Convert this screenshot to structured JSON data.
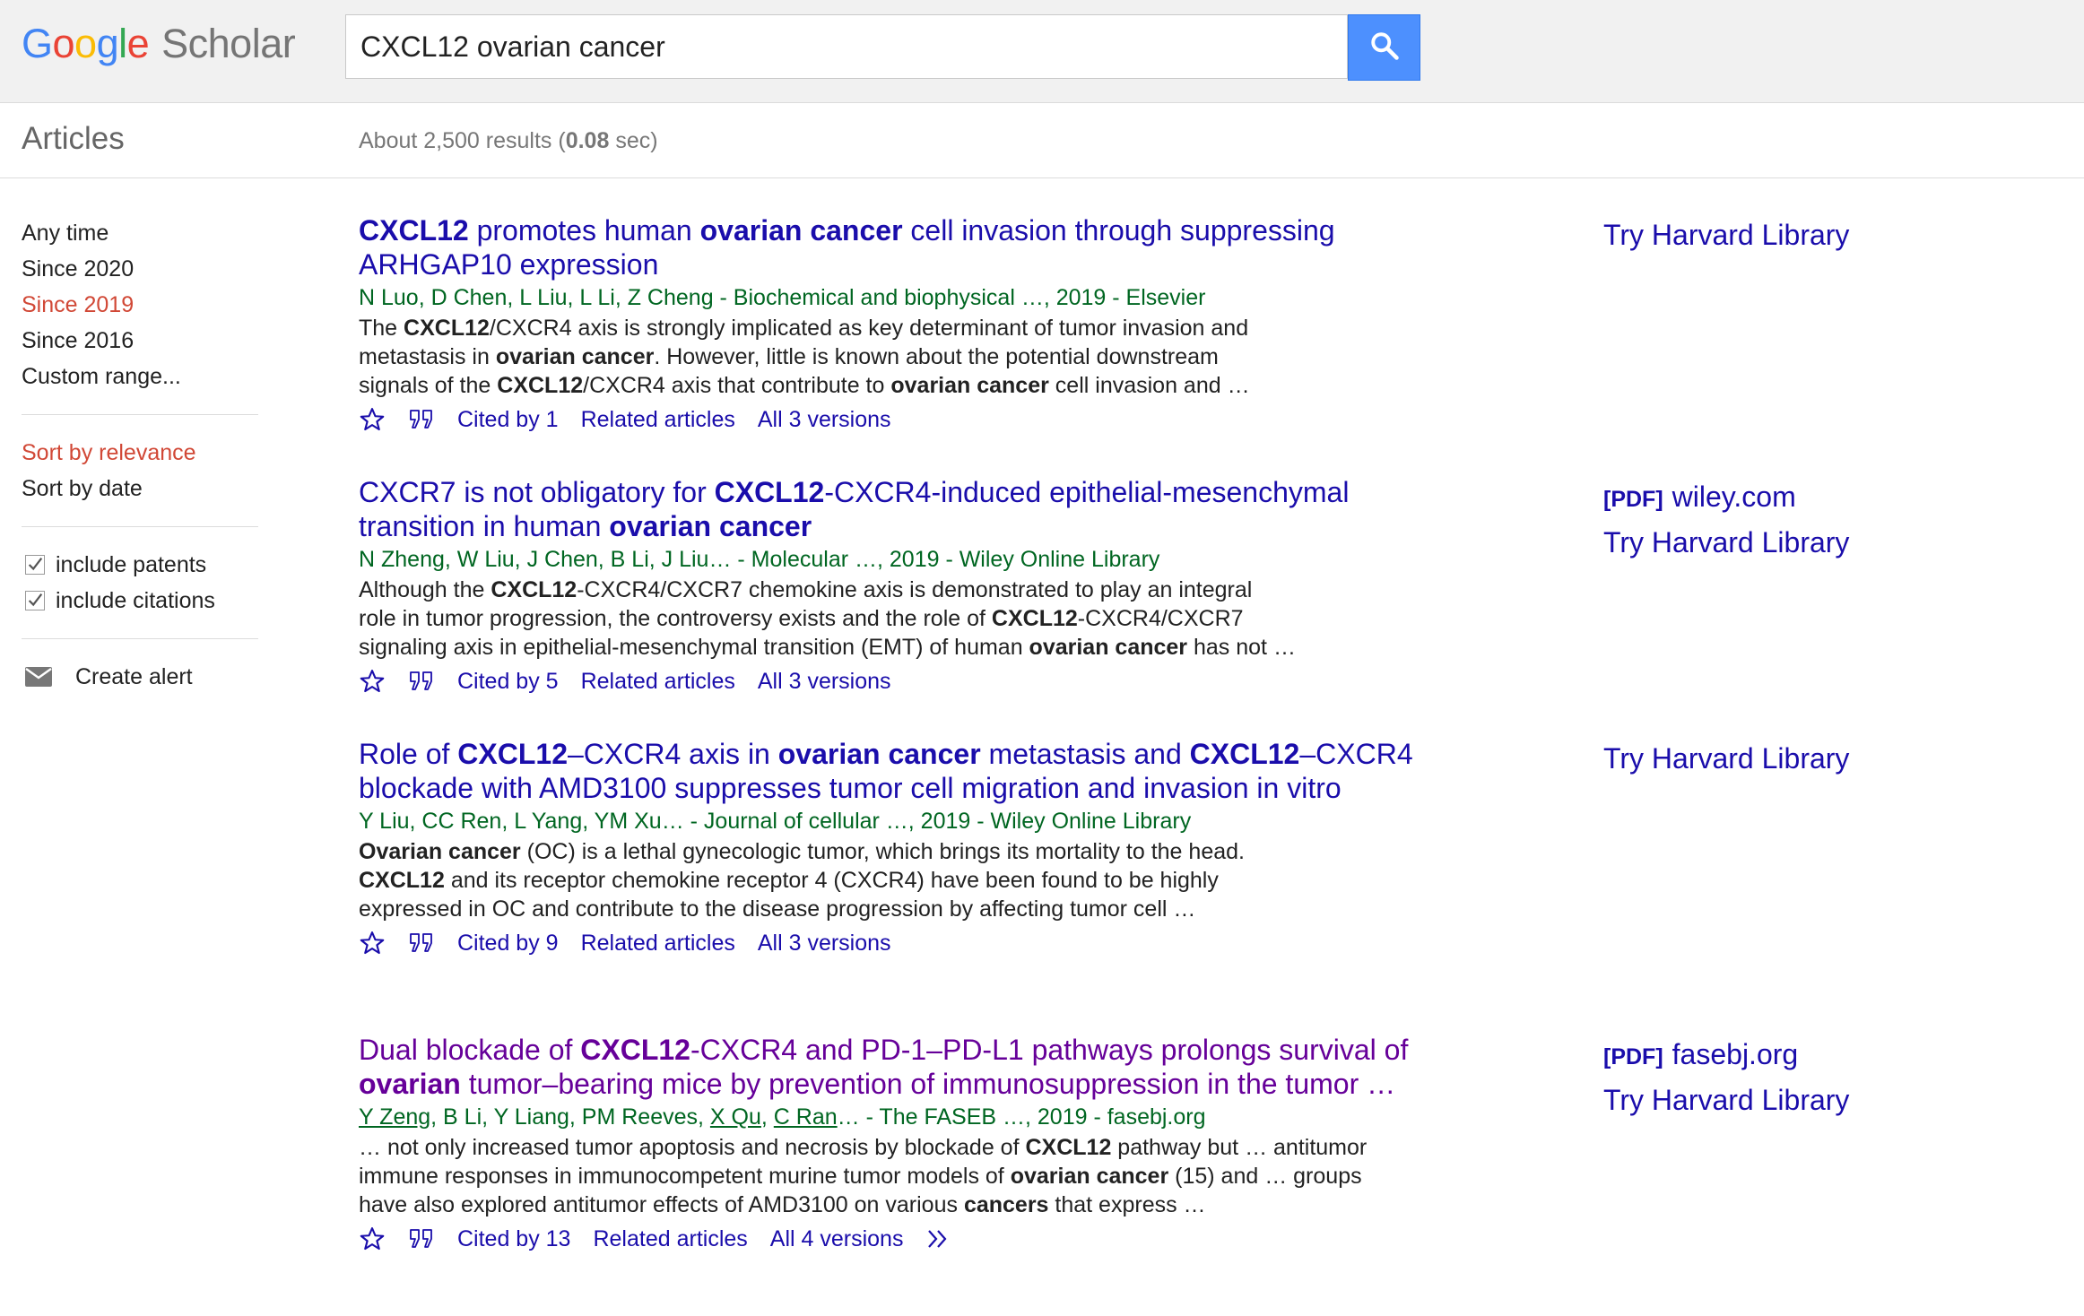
{
  "header": {
    "logo": {
      "google": [
        "G",
        "o",
        "o",
        "g",
        "l",
        "e"
      ],
      "scholar": "Scholar"
    },
    "search": {
      "value": "CXCL12 ovarian cancer"
    }
  },
  "subbar": {
    "section_label": "Articles",
    "results_prefix": "About 2,500 results (",
    "results_time": "0.08",
    "results_suffix": " sec)"
  },
  "sidebar": {
    "time_filters": [
      "Any time",
      "Since 2020",
      "Since 2019",
      "Since 2016",
      "Custom range..."
    ],
    "active_time_filter": "Since 2019",
    "sort_options": [
      "Sort by relevance",
      "Sort by date"
    ],
    "active_sort": "Sort by relevance",
    "include_patents": {
      "label": "include patents",
      "checked": true
    },
    "include_citations": {
      "label": "include citations",
      "checked": true
    },
    "create_alert": "Create alert"
  },
  "results": [
    {
      "title": [
        {
          "t": "CXCL12",
          "b": true
        },
        {
          "t": " promotes human "
        },
        {
          "t": "ovarian cancer",
          "b": true
        },
        {
          "t": " cell invasion through suppressing ARHGAP10 expression"
        }
      ],
      "visited": false,
      "meta": "N Luo, D Chen, L Liu, L Li, Z Cheng - Biochemical and biophysical …, 2019 - Elsevier",
      "snippet": [
        [
          {
            "t": "The "
          },
          {
            "t": "CXCL12",
            "b": true
          },
          {
            "t": "/CXCR4 axis is strongly implicated as key determinant of tumor invasion and"
          }
        ],
        [
          {
            "t": "metastasis in "
          },
          {
            "t": "ovarian cancer",
            "b": true
          },
          {
            "t": ". However, little is known about the potential downstream"
          }
        ],
        [
          {
            "t": "signals of the "
          },
          {
            "t": "CXCL12",
            "b": true
          },
          {
            "t": "/CXCR4 axis that contribute to "
          },
          {
            "t": "ovarian cancer",
            "b": true
          },
          {
            "t": " cell invasion and …"
          }
        ]
      ],
      "cited_by": "Cited by 1",
      "related": "Related articles",
      "versions": "All 3 versions",
      "side": [
        {
          "label": "Try Harvard Library"
        }
      ]
    },
    {
      "title": [
        {
          "t": "CXCR7 is not obligatory for "
        },
        {
          "t": "CXCL12",
          "b": true
        },
        {
          "t": "-CXCR4-induced epithelial-mesenchymal transition in human "
        },
        {
          "t": "ovarian cancer",
          "b": true
        }
      ],
      "visited": false,
      "meta": "N Zheng, W Liu, J Chen, B Li, J Liu… - Molecular …, 2019 - Wiley Online Library",
      "snippet": [
        [
          {
            "t": "Although the "
          },
          {
            "t": "CXCL12",
            "b": true
          },
          {
            "t": "-CXCR4/CXCR7 chemokine axis is demonstrated to play an integral"
          }
        ],
        [
          {
            "t": "role in tumor progression, the controversy exists and the role of "
          },
          {
            "t": "CXCL12",
            "b": true
          },
          {
            "t": "-CXCR4/CXCR7"
          }
        ],
        [
          {
            "t": "signaling axis in epithelial-mesenchymal transition (EMT) of human "
          },
          {
            "t": "ovarian cancer",
            "b": true
          },
          {
            "t": " has not …"
          }
        ]
      ],
      "cited_by": "Cited by 5",
      "related": "Related articles",
      "versions": "All 3 versions",
      "side": [
        {
          "pdf": "[PDF]",
          "label": "wiley.com"
        },
        {
          "label": "Try Harvard Library"
        }
      ]
    },
    {
      "title": [
        {
          "t": "Role of "
        },
        {
          "t": "CXCL12",
          "b": true
        },
        {
          "t": "–CXCR4 axis in "
        },
        {
          "t": "ovarian cancer",
          "b": true
        },
        {
          "t": " metastasis and "
        },
        {
          "t": "CXCL12",
          "b": true
        },
        {
          "t": "–CXCR4 blockade with AMD3100 suppresses tumor cell migration and invasion in vitro"
        }
      ],
      "visited": false,
      "meta": "Y Liu, CC Ren, L Yang, YM Xu… - Journal of cellular …, 2019 - Wiley Online Library",
      "snippet": [
        [
          {
            "t": "Ovarian cancer",
            "b": true
          },
          {
            "t": " (OC) is a lethal gynecologic tumor, which brings its mortality to the head."
          }
        ],
        [
          {
            "t": "CXCL12",
            "b": true
          },
          {
            "t": " and its receptor chemokine receptor 4 (CXCR4) have been found to be highly"
          }
        ],
        [
          {
            "t": "expressed in OC and contribute to the disease progression by affecting tumor cell …"
          }
        ]
      ],
      "cited_by": "Cited by 9",
      "related": "Related articles",
      "versions": "All 3 versions",
      "side": [
        {
          "label": "Try Harvard Library"
        }
      ]
    },
    {
      "title": [
        {
          "t": "Dual blockade of "
        },
        {
          "t": "CXCL12",
          "b": true
        },
        {
          "t": "-CXCR4 and PD-1–PD-L1 pathways prolongs survival of "
        },
        {
          "t": "ovarian",
          "b": true
        },
        {
          "t": " tumor–bearing mice by prevention of immunosuppression in the tumor …"
        }
      ],
      "visited": true,
      "meta_parts": [
        {
          "t": "Y Zeng",
          "u": true
        },
        {
          "t": ", B Li, Y Liang, PM Reeves, "
        },
        {
          "t": "X Qu",
          "u": true
        },
        {
          "t": ", "
        },
        {
          "t": "C Ran",
          "u": true
        },
        {
          "t": "… - The FASEB …, 2019 - fasebj.org"
        }
      ],
      "snippet": [
        [
          {
            "t": "… not only increased tumor apoptosis and necrosis by blockade of "
          },
          {
            "t": "CXCL12",
            "b": true
          },
          {
            "t": " pathway but … antitumor"
          }
        ],
        [
          {
            "t": "immune responses in immunocompetent murine tumor models of "
          },
          {
            "t": "ovarian cancer",
            "b": true
          },
          {
            "t": " (15) and … groups"
          }
        ],
        [
          {
            "t": "have also explored antitumor effects of AMD3100 on various "
          },
          {
            "t": "cancers",
            "b": true
          },
          {
            "t": " that express …"
          }
        ]
      ],
      "cited_by": "Cited by 13",
      "related": "Related articles",
      "versions": "All 4 versions",
      "has_more": true,
      "side": [
        {
          "pdf": "[PDF]",
          "label": "fasebj.org"
        },
        {
          "label": "Try Harvard Library"
        }
      ]
    }
  ],
  "colors": {
    "link": "#1a0dab",
    "visited": "#660099",
    "meta": "#006621",
    "active_filter": "#d14836",
    "search_button": "#4d90fe",
    "header_bg": "#f1f1f1"
  },
  "icons": {
    "search": "search-icon",
    "star": "star-icon",
    "cite": "quote-icon",
    "more": "double-chevron-icon",
    "mail": "mail-icon",
    "check": "checkmark-icon"
  }
}
